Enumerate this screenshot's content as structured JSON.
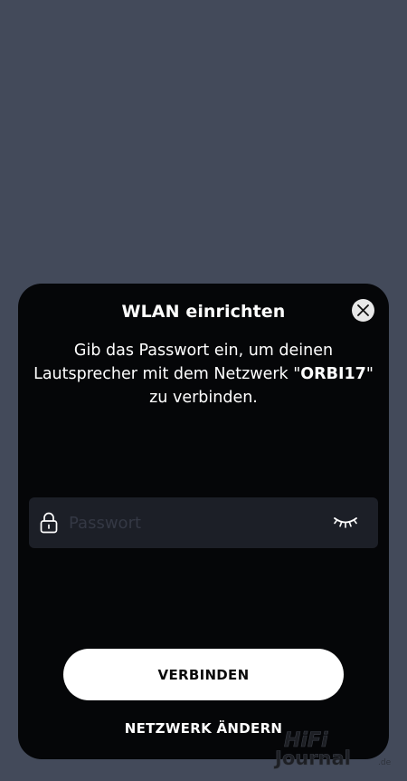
{
  "dialog": {
    "title": "WLAN einrichten",
    "description_before": "Gib das Passwort ein, um deinen Lautsprecher mit dem Netzwerk \"",
    "network_name": "ORBI17",
    "description_after": "\" zu verbinden.",
    "password_field": {
      "placeholder": "Passwort",
      "value": ""
    },
    "connect_label": "VERBINDEN",
    "change_network_label": "NETZWERK ÄNDERN"
  },
  "watermark": {
    "text_top": "HiFi",
    "text_bottom": "Journal",
    "suffix": ".de"
  },
  "icons": {
    "close": "close-icon",
    "lock": "lock-icon",
    "eye": "eye-closed-icon"
  },
  "colors": {
    "background": "#434a5a",
    "sheet": "#050608",
    "field": "#1c1f27",
    "button": "#ffffff"
  }
}
